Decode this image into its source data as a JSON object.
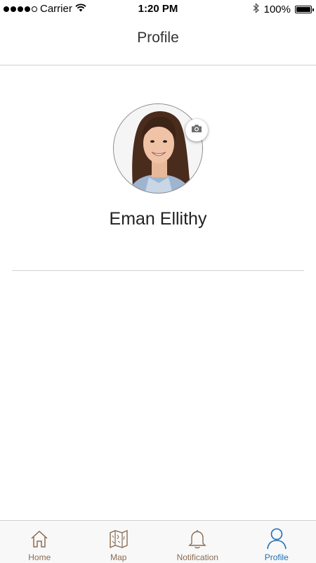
{
  "status_bar": {
    "carrier": "Carrier",
    "time": "1:20 PM",
    "battery_percent": "100%",
    "battery_level": 1.0,
    "signal_bars": 4,
    "icons": [
      "signal-dots-icon",
      "wifi-icon",
      "bluetooth-icon",
      "battery-icon"
    ]
  },
  "nav": {
    "title": "Profile"
  },
  "profile": {
    "name": "Eman Ellithy",
    "avatar": "profile-photo",
    "camera_icon": "camera-icon"
  },
  "tab_bar": {
    "tabs": [
      {
        "label": "Home",
        "icon": "home-icon",
        "active": false
      },
      {
        "label": "Map",
        "icon": "map-icon",
        "active": false
      },
      {
        "label": "Notification",
        "icon": "bell-icon",
        "active": false
      },
      {
        "label": "Profile",
        "icon": "person-icon",
        "active": true
      }
    ]
  },
  "colors": {
    "accent": "#1f6fb5",
    "tab_inactive": "#8a6b52",
    "divider": "#d4d4d4"
  }
}
